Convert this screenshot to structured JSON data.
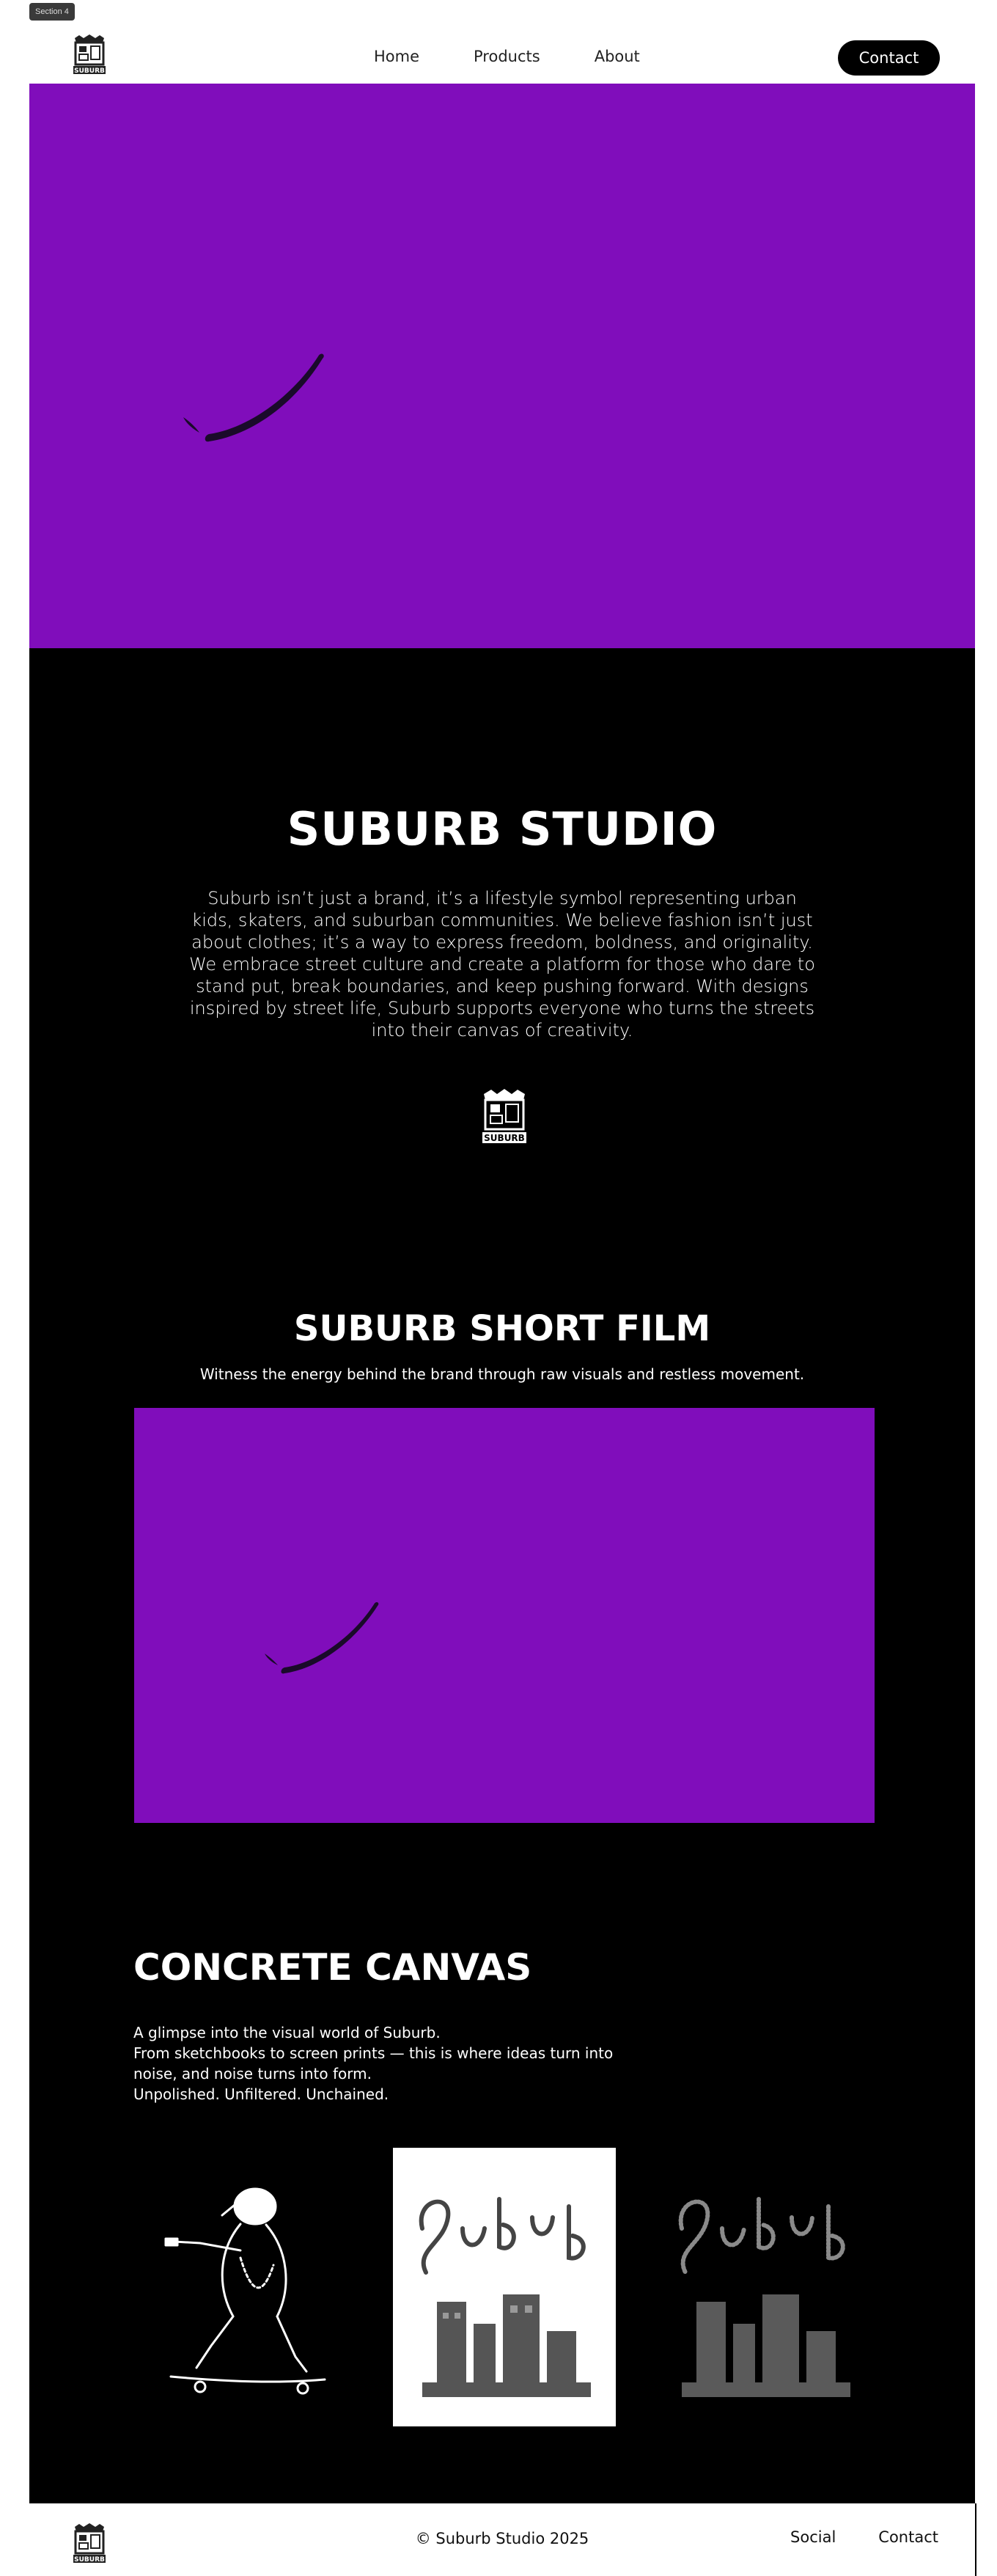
{
  "section_tag": "Section 4",
  "header": {
    "nav": [
      {
        "label": "Home"
      },
      {
        "label": "Products"
      },
      {
        "label": "About"
      }
    ],
    "contact_label": "Contact"
  },
  "colors": {
    "hero_bg": "#800dbb",
    "main_bg": "#000000",
    "text_light": "#ffffff"
  },
  "brand": {
    "title": "SUBURB STUDIO",
    "description": "Suburb isn’t just a brand, it’s a lifestyle symbol representing urban kids, skaters, and suburban communities. We believe fashion isn’t just about clothes; it’s a way to express freedom, boldness, and originality. We embrace street culture and create a platform for those who dare to stand put, break boundaries, and keep pushing forward. With designs inspired by street life, Suburb supports everyone who turns the streets into their canvas of creativity.",
    "logo_text": "SUBURB"
  },
  "film": {
    "title": "SUBURB SHORT FILM",
    "subtitle": "Witness the energy behind the brand through raw visuals and restless movement."
  },
  "canvas": {
    "title": "CONCRETE CANVAS",
    "lines": [
      "A glimpse into the visual world of Suburb.",
      "From sketchbooks to screen prints — this is where ideas turn into noise, and noise turns into form.",
      "Unpolished. Unfiltered. Unchained."
    ],
    "gallery": [
      {
        "name": "skater-illustration"
      },
      {
        "name": "suburb-graffiti-print-white"
      },
      {
        "name": "suburb-graffiti-print-dark"
      }
    ]
  },
  "footer": {
    "copyright": "© Suburb Studio 2025",
    "links": [
      {
        "label": "Social"
      },
      {
        "label": "Contact"
      }
    ]
  }
}
